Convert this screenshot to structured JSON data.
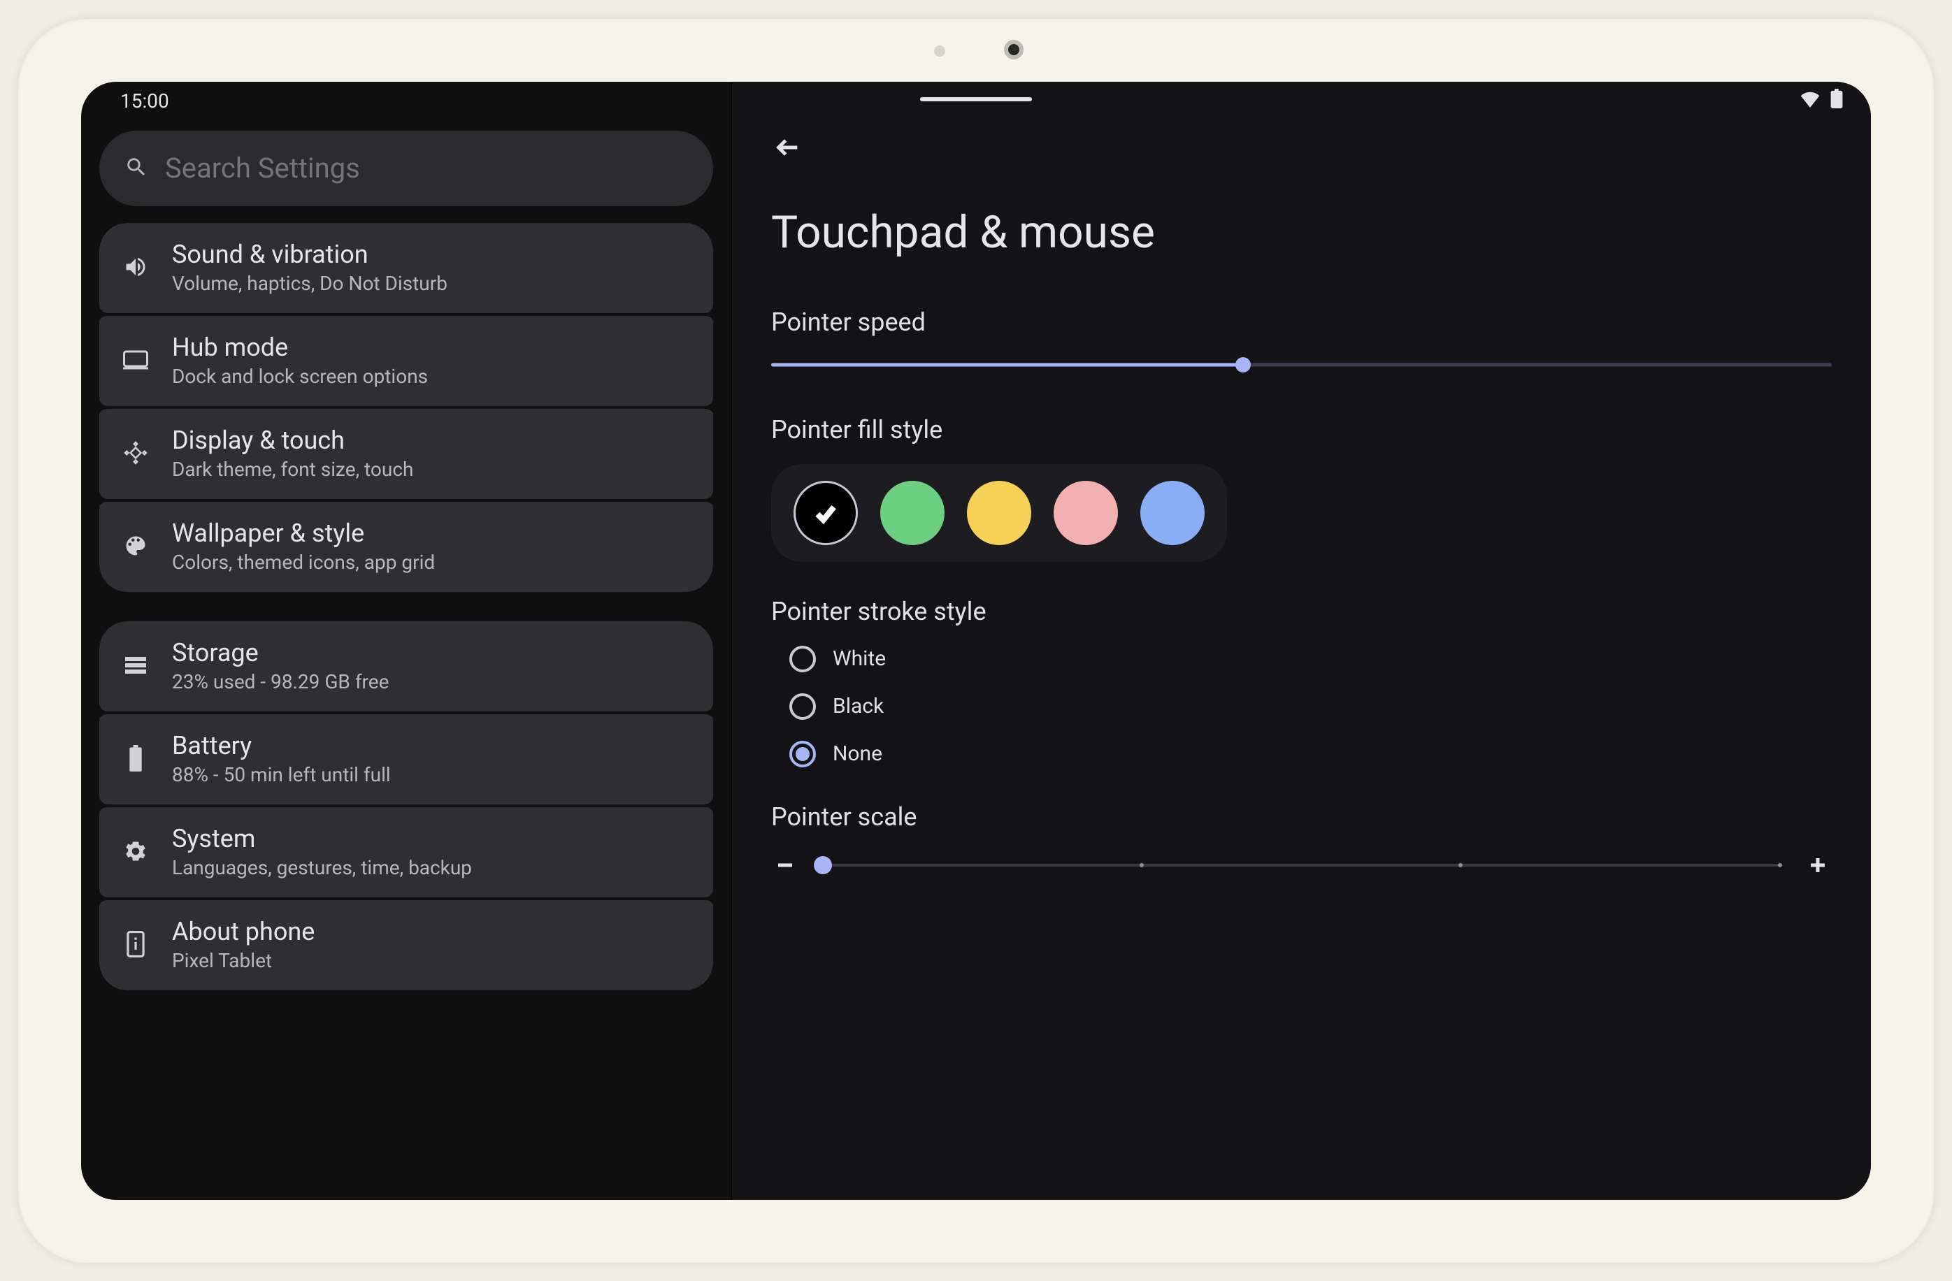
{
  "status": {
    "time": "15:00"
  },
  "search": {
    "placeholder": "Search Settings"
  },
  "sidebar": {
    "groups": [
      [
        {
          "icon": "volume",
          "title": "Sound & vibration",
          "sub": "Volume, haptics, Do Not Disturb"
        },
        {
          "icon": "hub",
          "title": "Hub mode",
          "sub": "Dock and lock screen options"
        },
        {
          "icon": "display",
          "title": "Display & touch",
          "sub": "Dark theme, font size, touch"
        },
        {
          "icon": "palette",
          "title": "Wallpaper & style",
          "sub": "Colors, themed icons, app grid"
        }
      ],
      [
        {
          "icon": "storage",
          "title": "Storage",
          "sub": "23% used - 98.29 GB free"
        },
        {
          "icon": "battery",
          "title": "Battery",
          "sub": "88% - 50 min left until full"
        },
        {
          "icon": "gear",
          "title": "System",
          "sub": "Languages, gestures, time, backup"
        },
        {
          "icon": "phone",
          "title": "About phone",
          "sub": "Pixel Tablet"
        }
      ]
    ]
  },
  "detail": {
    "title": "Touchpad & mouse",
    "speed": {
      "label": "Pointer speed",
      "percent": 44.5
    },
    "fill": {
      "label": "Pointer fill style",
      "options": [
        {
          "color": "#000000",
          "selected": true
        },
        {
          "color": "#6dcf82",
          "selected": false
        },
        {
          "color": "#f5d156",
          "selected": false
        },
        {
          "color": "#f3b0b0",
          "selected": false
        },
        {
          "color": "#8aaef5",
          "selected": false
        }
      ]
    },
    "stroke": {
      "label": "Pointer stroke style",
      "options": [
        {
          "label": "White",
          "checked": false
        },
        {
          "label": "Black",
          "checked": false
        },
        {
          "label": "None",
          "checked": true
        }
      ]
    },
    "scale": {
      "label": "Pointer scale",
      "percent": 0,
      "ticks": [
        0,
        33.3,
        66.6,
        100
      ]
    }
  }
}
